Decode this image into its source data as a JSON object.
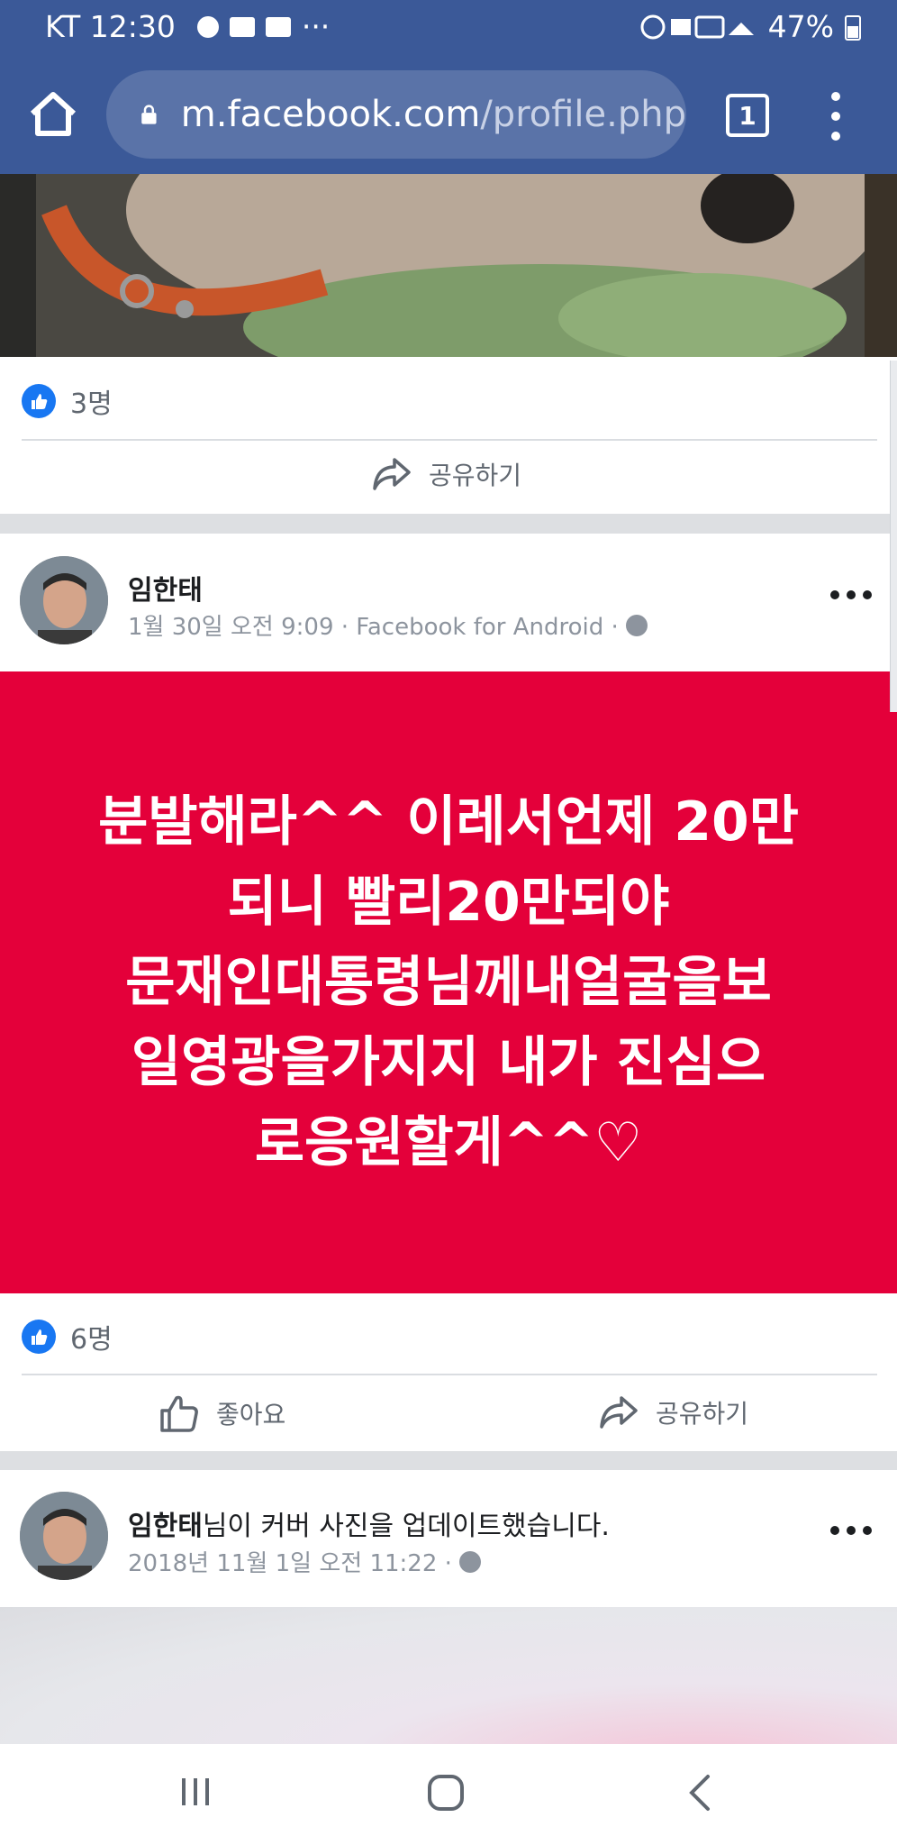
{
  "status_bar": {
    "carrier_time": "KT 12:30",
    "more": "···",
    "battery": "47%"
  },
  "browser": {
    "url_host": "m.facebook.com",
    "url_path": "/profile.php",
    "tab_count": "1"
  },
  "post_prev": {
    "like_count": "3명",
    "share_label": "공유하기"
  },
  "post_main": {
    "author": "임한태",
    "meta": "1월 30일 오전 9:09 · Facebook for Android ·",
    "text": "분발해라^^ 이레서언제 20만\n되니 빨리20만되야\n문재인대통령님께내얼굴을보\n일영광을가지지 내가 진심으\n로응원할게^^♡",
    "background_color": "#e4003a",
    "like_count": "6명",
    "like_label": "좋아요",
    "share_label": "공유하기"
  },
  "post_cover": {
    "author": "임한태",
    "action_text": "님이 커버 사진을 업데이트했습니다.",
    "meta": "2018년 11월 1일 오전 11:22 ·"
  },
  "colors": {
    "facebook_blue": "#3b5998",
    "like_blue": "#1877f2"
  },
  "icons": [
    "home-icon",
    "lock-icon",
    "tab-switcher-icon",
    "overflow-menu-icon",
    "like-badge-icon",
    "share-icon",
    "thumbs-up-icon",
    "globe-icon",
    "more-options-icon",
    "recents-icon",
    "home-nav-icon",
    "back-icon"
  ]
}
